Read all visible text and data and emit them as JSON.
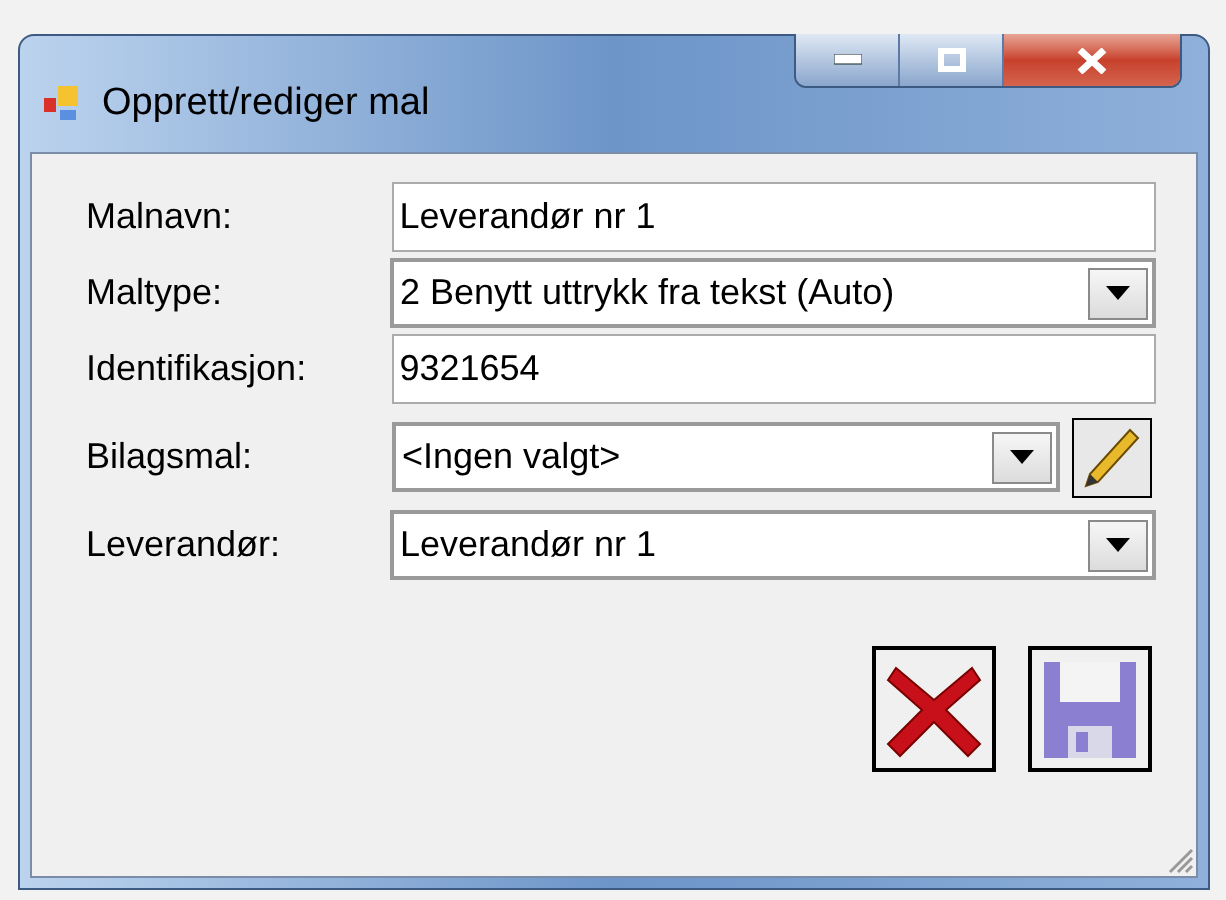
{
  "window": {
    "title": "Opprett/rediger mal"
  },
  "fields": [
    {
      "label": "Malnavn:",
      "kind": "text",
      "value": "Leverandør nr 1"
    },
    {
      "label": "Maltype:",
      "kind": "combo",
      "value": "2 Benytt uttrykk fra tekst (Auto)"
    },
    {
      "label": "Identifikasjon:",
      "kind": "text",
      "value": "9321654"
    },
    {
      "label": "Bilagsmal:",
      "kind": "combo-edit",
      "value": "<Ingen valgt>"
    },
    {
      "label": "Leverandør:",
      "kind": "combo",
      "value": "Leverandør nr 1"
    }
  ]
}
